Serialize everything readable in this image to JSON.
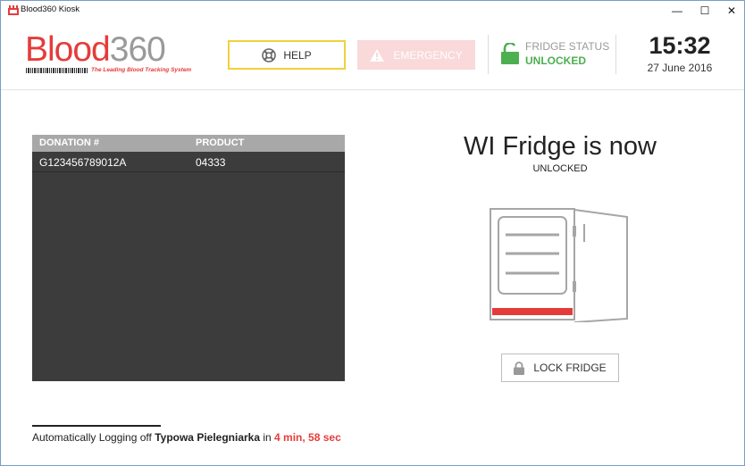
{
  "window": {
    "title": "Blood360 Kiosk",
    "controls": {
      "minimize": "—",
      "maximize": "☐",
      "close": "✕"
    }
  },
  "header": {
    "logo": {
      "part1": "Blood",
      "part2": "360",
      "tagline": "The Leading Blood Tracking System"
    },
    "help_label": "HELP",
    "emergency_label": "EMERGENCY",
    "fridge_status": {
      "label": "FRIDGE STATUS",
      "value": "UNLOCKED"
    },
    "clock": {
      "time": "15:32",
      "date": "27 June 2016"
    }
  },
  "table": {
    "columns": [
      "DONATION #",
      "PRODUCT"
    ],
    "rows": [
      {
        "donation": "G123456789012A",
        "product": "04333"
      }
    ]
  },
  "status": {
    "title": "WI Fridge is now",
    "subtitle": "UNLOCKED",
    "lock_button_label": "LOCK FRIDGE"
  },
  "logoff": {
    "prefix": "Automatically Logging off ",
    "user": "Typowa Pielegniarka",
    "mid": " in ",
    "countdown": "4 min, 58 sec"
  },
  "colors": {
    "brand_red": "#e53c3a",
    "help_border": "#f2d13a",
    "emergency_bg": "#f9d9d9",
    "status_green": "#4caf50",
    "table_bg": "#3c3c3c",
    "table_header_bg": "#a8a8a8"
  },
  "icons": {
    "app": "app-icon",
    "help": "lifebuoy-icon",
    "emergency": "warning-icon",
    "fridge_status": "unlocked-padlock-icon",
    "lock_button": "padlock-icon",
    "fridge": "open-fridge-icon"
  }
}
